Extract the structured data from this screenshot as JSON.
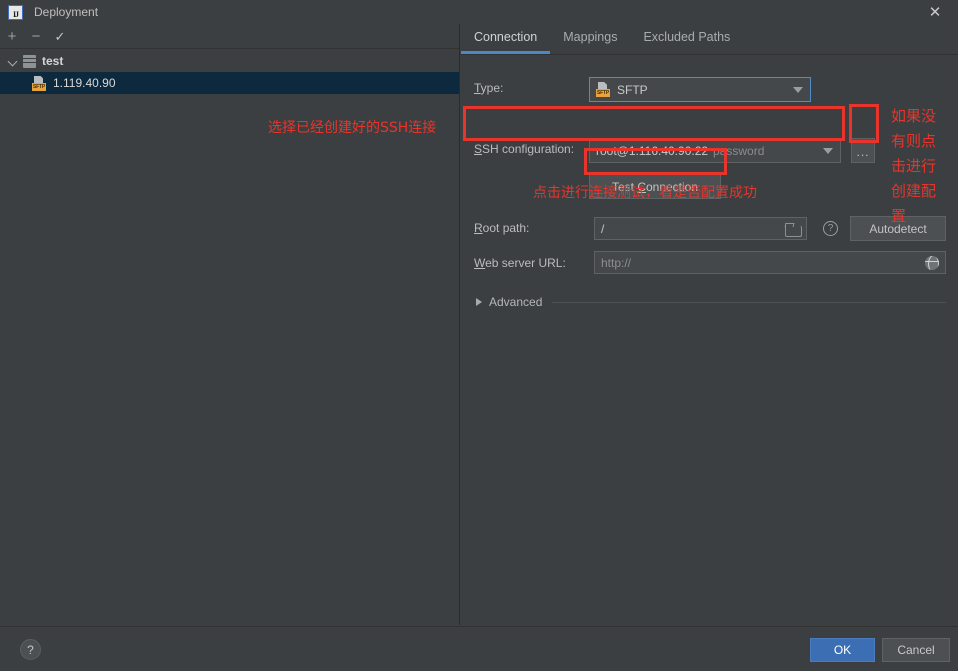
{
  "window": {
    "title": "Deployment",
    "logo_icon": "intellij-idea-icon",
    "close_icon": "close-icon"
  },
  "left_panel": {
    "toolbar": [
      {
        "name": "add-server-button",
        "icon": "plus-icon",
        "label": "+"
      },
      {
        "name": "remove-server-button",
        "icon": "minus-icon",
        "label": "−"
      },
      {
        "name": "use-as-default-button",
        "icon": "check-icon",
        "label": "✓"
      }
    ],
    "tree": [
      {
        "label": "test",
        "type": "group",
        "icon": "server-group-icon",
        "expanded": true,
        "selected": false
      },
      {
        "label": "1.119.40.90",
        "type": "server",
        "icon": "sftp-icon",
        "icon_text": "SFTP",
        "selected": true
      }
    ]
  },
  "right_panel": {
    "tabs": [
      {
        "label": "Connection",
        "active": true
      },
      {
        "label": "Mappings",
        "active": false
      },
      {
        "label": "Excluded Paths",
        "active": false
      }
    ],
    "fields": {
      "type": {
        "label": "Type:",
        "mnemonic": "T",
        "value": "SFTP",
        "icon": "sftp-icon",
        "icon_text": "SFTP",
        "dropdown_icon": "chevron-down-icon"
      },
      "ssh_configuration": {
        "label": "SSH configuration:",
        "mnemonic": "S",
        "value": "root@1.116.40.90:22",
        "value_suffix": "password",
        "dropdown_icon": "chevron-down-icon",
        "browse_button_label": "...",
        "browse_button_name": "ssh-config-browse-button"
      },
      "test_connection": {
        "label": "Test Connection",
        "mnemonic": "C"
      },
      "root_path": {
        "label": "Root path:",
        "mnemonic": "R",
        "value": "/",
        "browse_icon": "folder-icon",
        "help_icon": "help-circle-icon",
        "autodetect_label": "Autodetect"
      },
      "web_server_url": {
        "label": "Web server URL:",
        "mnemonic": "W",
        "value": "http://",
        "open_icon": "globe-icon"
      }
    },
    "advanced": {
      "label": "Advanced",
      "expand_icon": "chevron-right-icon",
      "expanded": false
    }
  },
  "bottom_bar": {
    "help_icon": "help-circle-icon",
    "help_label": "?",
    "ok_label": "OK",
    "cancel_label": "Cancel"
  },
  "annotations": {
    "color": "#e8342a",
    "ssh_note": "选择已经创建好的SSH连接",
    "test_note": "点击进行连接测试，看是否配置成功",
    "browse_note_lines": [
      "如果没",
      "有则点",
      "击进行",
      "创建配",
      "置"
    ]
  }
}
